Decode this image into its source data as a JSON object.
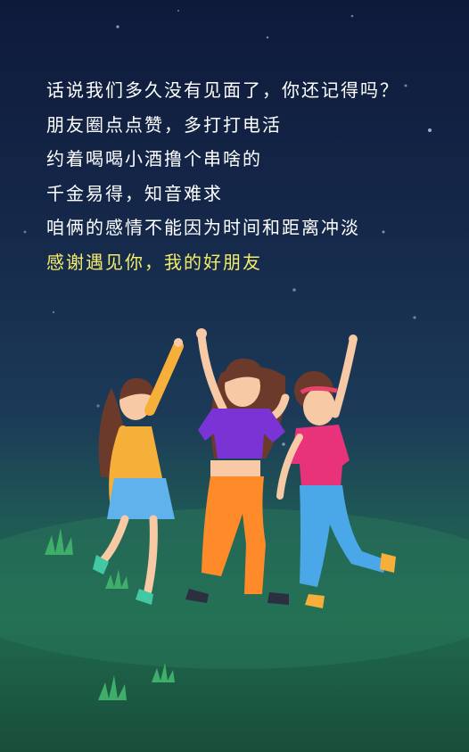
{
  "poem": {
    "lines": [
      "话说我们多久没有见面了，你还记得吗？",
      "朋友圈点点赞，多打打电活",
      "约着喝喝小酒撸个串啥的",
      "千金易得，知音难求",
      "咱俩的感情不能因为时间和距离冲淡"
    ],
    "highlight_line": "感谢遇见你，我的好朋友"
  },
  "colors": {
    "text": "#ffffff",
    "highlight": "#f4ec6a",
    "sky_top": "#0e1a3a",
    "grass": "#1f6a4f"
  }
}
